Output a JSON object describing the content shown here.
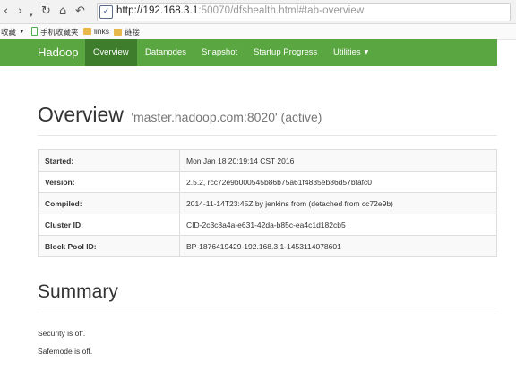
{
  "browser": {
    "url_host": "http://192.168.3.1",
    "url_rest": ":50070/dfshealth.html#tab-overview",
    "bookmarks": [
      {
        "icon": "phone-icon",
        "label": "手机收藏夹"
      },
      {
        "icon": "folder-icon",
        "label": "links"
      },
      {
        "icon": "folder-icon",
        "label": "链接"
      }
    ],
    "bookmarks_label": "收藏"
  },
  "navbar": {
    "brand": "Hadoop",
    "items": [
      "Overview",
      "Datanodes",
      "Snapshot",
      "Startup Progress",
      "Utilities"
    ],
    "active": "Overview",
    "color": "#5aa641",
    "active_color": "#3e7d2c"
  },
  "overview": {
    "title": "Overview",
    "subtitle": "'master.hadoop.com:8020' (active)",
    "rows": [
      {
        "key": "Started:",
        "value": "Mon Jan 18 20:19:14 CST 2016"
      },
      {
        "key": "Version:",
        "value": "2.5.2, rcc72e9b000545b86b75a61f4835eb86d57bfafc0"
      },
      {
        "key": "Compiled:",
        "value": "2014-11-14T23:45Z by jenkins from (detached from cc72e9b)"
      },
      {
        "key": "Cluster ID:",
        "value": "CID-2c3c8a4a-e631-42da-b85c-ea4c1d182cb5"
      },
      {
        "key": "Block Pool ID:",
        "value": "BP-1876419429-192.168.3.1-1453114078601"
      }
    ]
  },
  "summary": {
    "title": "Summary",
    "lines": [
      "Security is off.",
      "Safemode is off."
    ]
  }
}
